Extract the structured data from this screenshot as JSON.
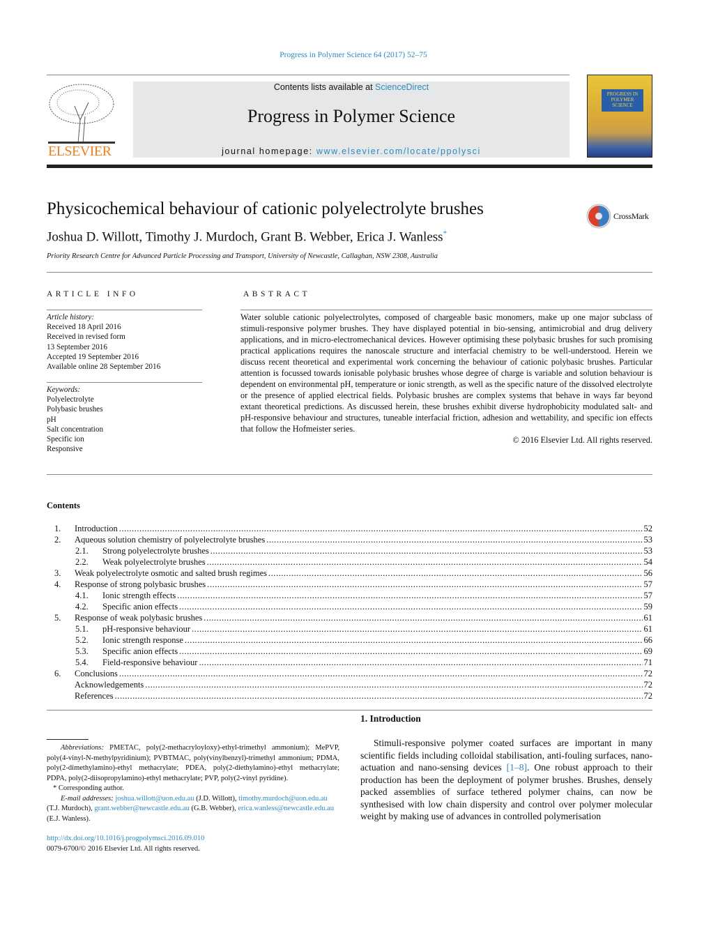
{
  "header": {
    "citation": "Progress in Polymer Science 64 (2017) 52–75",
    "contents_prefix": "Contents lists available at ",
    "sciencedirect": "ScienceDirect",
    "journal_title": "Progress in Polymer Science",
    "homepage_prefix": "journal homepage: ",
    "homepage_url": "www.elsevier.com/locate/ppolysci",
    "publisher_logo": "ELSEVIER",
    "cover_text": "PROGRESS IN POLYMER SCIENCE",
    "crossmark": "CrossMark"
  },
  "article": {
    "title": "Physicochemical behaviour of cationic polyelectrolyte brushes",
    "authors": "Joshua D. Willott, Timothy J. Murdoch, Grant B. Webber, Erica J. Wanless",
    "corresponding_mark": "*",
    "affiliation": "Priority Research Centre for Advanced Particle Processing and Transport, University of Newcastle, Callaghan, NSW 2308, Australia"
  },
  "article_info": {
    "heading": "ARTICLE INFO",
    "history_label": "Article history:",
    "history": [
      "Received 18 April 2016",
      "Received in revised form",
      "13 September 2016",
      "Accepted 19 September 2016",
      "Available online 28 September 2016"
    ],
    "keywords_label": "Keywords:",
    "keywords": [
      "Polyelectrolyte",
      "Polybasic brushes",
      "pH",
      "Salt concentration",
      "Specific ion",
      "Responsive"
    ]
  },
  "abstract": {
    "heading": "ABSTRACT",
    "text": "Water soluble cationic polyelectrolytes, composed of chargeable basic monomers, make up one major subclass of stimuli-responsive polymer brushes. They have displayed potential in bio-sensing, antimicrobial and drug delivery applications, and in micro-electromechanical devices. However optimising these polybasic brushes for such promising practical applications requires the nanoscale structure and interfacial chemistry to be well-understood. Herein we discuss recent theoretical and experimental work concerning the behaviour of cationic polybasic brushes. Particular attention is focussed towards ionisable polybasic brushes whose degree of charge is variable and solution behaviour is dependent on environmental pH, temperature or ionic strength, as well as the specific nature of the dissolved electrolyte or the presence of applied electrical fields. Polybasic brushes are complex systems that behave in ways far beyond extant theoretical predictions. As discussed herein, these brushes exhibit diverse hydrophobicity modulated salt- and pH-responsive behaviour and structures, tuneable interfacial friction, adhesion and wettability, and specific ion effects that follow the Hofmeister series.",
    "copyright": "© 2016 Elsevier Ltd. All rights reserved."
  },
  "contents": {
    "heading": "Contents",
    "items": [
      {
        "num": "1.",
        "title": "Introduction",
        "page": "52",
        "sub": false
      },
      {
        "num": "2.",
        "title": "Aqueous solution chemistry of polyelectrolyte brushes",
        "page": "53",
        "sub": false
      },
      {
        "num": "2.1.",
        "title": "Strong polyelectrolyte brushes",
        "page": "53",
        "sub": true
      },
      {
        "num": "2.2.",
        "title": "Weak polyelectrolyte brushes",
        "page": "54",
        "sub": true
      },
      {
        "num": "3.",
        "title": "Weak polyelectrolyte osmotic and salted brush regimes",
        "page": "56",
        "sub": false
      },
      {
        "num": "4.",
        "title": "Response of strong polybasic brushes",
        "page": "57",
        "sub": false
      },
      {
        "num": "4.1.",
        "title": "Ionic strength effects",
        "page": "57",
        "sub": true
      },
      {
        "num": "4.2.",
        "title": "Specific anion effects",
        "page": "59",
        "sub": true
      },
      {
        "num": "5.",
        "title": "Response of weak polybasic brushes",
        "page": "61",
        "sub": false
      },
      {
        "num": "5.1.",
        "title": "pH-responsive behaviour",
        "page": "61",
        "sub": true
      },
      {
        "num": "5.2.",
        "title": "Ionic strength response",
        "page": "66",
        "sub": true
      },
      {
        "num": "5.3.",
        "title": "Specific anion effects",
        "page": "69",
        "sub": true
      },
      {
        "num": "5.4.",
        "title": "Field-responsive behaviour",
        "page": "71",
        "sub": true
      },
      {
        "num": "6.",
        "title": "Conclusions",
        "page": "72",
        "sub": false
      },
      {
        "num": "",
        "title": "Acknowledgements",
        "page": "72",
        "sub": false
      },
      {
        "num": "",
        "title": "References",
        "page": "72",
        "sub": false
      }
    ]
  },
  "footnotes": {
    "abbrev_label": "Abbreviations:",
    "abbrev_text": "PMETAC, poly(2-methacryloyloxy)-ethyl-trimethyl ammonium); MePVP, poly(4-vinyl-N-methylpyridinium); PVBTMAC, poly(vinylbenzyl)-trimethyl ammonium; PDMA, poly(2-dimethylamino)-ethyl methacrylate; PDEA, poly(2-diethylamino)-ethyl methacrylate; PDPA, poly(2-diisopropylamino)-ethyl methacrylate; PVP, poly(2-vinyl pyridine).",
    "corresponding": "* Corresponding author.",
    "email_label": "E-mail addresses:",
    "emails": [
      {
        "email": "joshua.willott@uon.edu.au",
        "name": "(J.D. Willott),"
      },
      {
        "email": "timothy.murdoch@uon.edu.au",
        "name": "(T.J. Murdoch),"
      },
      {
        "email": "grant.webber@newcastle.edu.au",
        "name": "(G.B. Webber),"
      },
      {
        "email": "erica.wanless@newcastle.edu.au",
        "name": "(E.J. Wanless)."
      }
    ],
    "doi": "http://dx.doi.org/10.1016/j.progpolymsci.2016.09.010",
    "issn": "0079-6700/© 2016 Elsevier Ltd. All rights reserved."
  },
  "intro": {
    "heading": "1.  Introduction",
    "text_before": "Stimuli-responsive polymer coated surfaces are important in many scientific fields including colloidal stabilisation, anti-fouling surfaces, nano-actuation and nano-sensing devices ",
    "ref": "[1–8]",
    "text_after": ". One robust approach to their production has been the deployment of polymer brushes. Brushes, densely packed assemblies of surface tethered polymer chains, can now be synthesised with low chain dispersity and control over polymer molecular weight by making use of advances in controlled polymerisation"
  }
}
